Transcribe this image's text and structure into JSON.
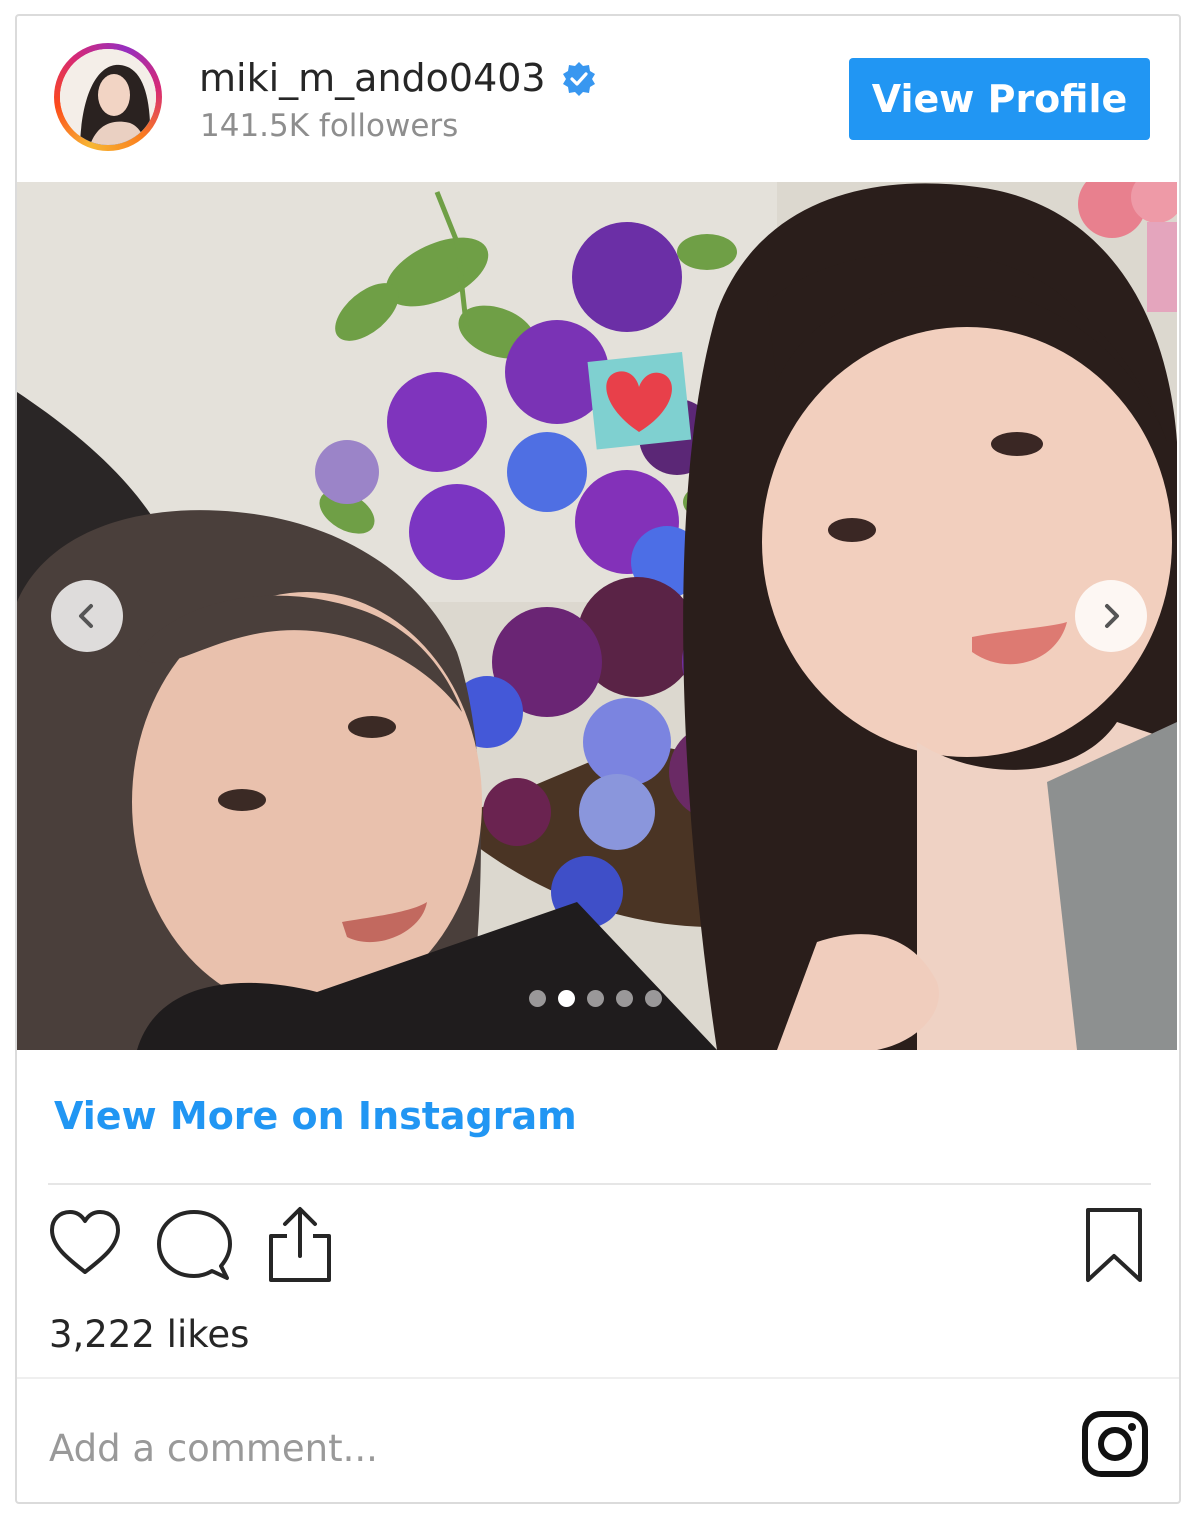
{
  "header": {
    "username": "miki_m_ando0403",
    "followers": "141.5K followers",
    "view_profile_label": "View Profile",
    "verified": true
  },
  "carousel": {
    "slide_count": 5,
    "active_index": 1,
    "prev_icon": "chevron-left-icon",
    "next_icon": "chevron-right-icon"
  },
  "links": {
    "view_more": "View More on Instagram"
  },
  "actions": {
    "icons": [
      "heart-icon",
      "comment-icon",
      "share-icon",
      "bookmark-icon"
    ]
  },
  "likes": "3,222 likes",
  "comment": {
    "placeholder": "Add a comment..."
  },
  "colors": {
    "accent": "#2196f3",
    "verified": "#3897f0",
    "text": "#262626",
    "muted": "#8e8e8e"
  }
}
